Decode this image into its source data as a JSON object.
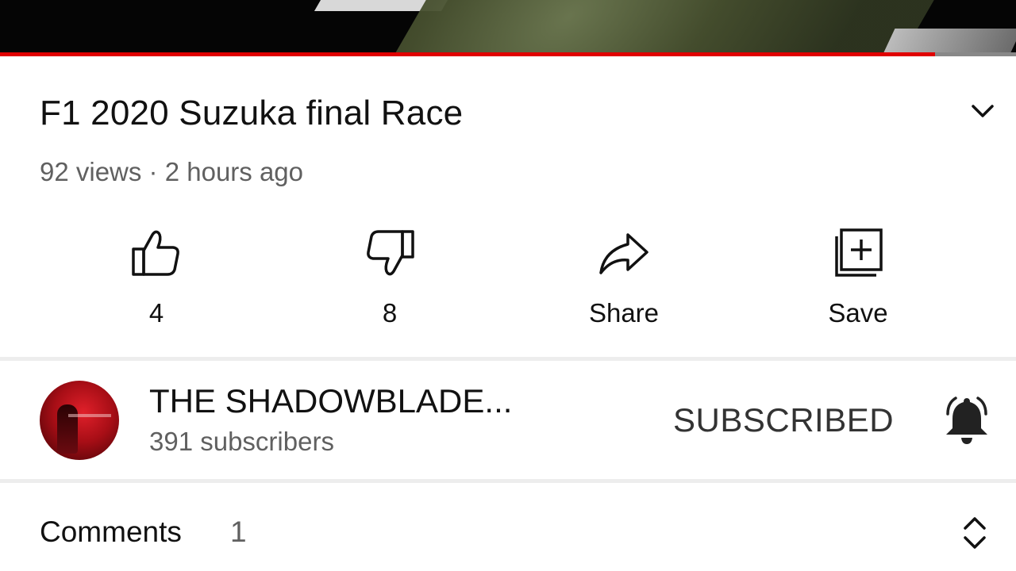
{
  "player": {
    "progress_fraction": 0.92,
    "progress_color": "#e00000"
  },
  "video": {
    "title": "F1 2020 Suzuka final Race",
    "meta": "92 views · 2 hours ago",
    "expand_icon": "chevron-down-icon"
  },
  "actions": {
    "like": {
      "label": "4",
      "icon": "thumbs-up-icon"
    },
    "dislike": {
      "label": "8",
      "icon": "thumbs-down-icon"
    },
    "share": {
      "label": "Share",
      "icon": "share-arrow-icon"
    },
    "save": {
      "label": "Save",
      "icon": "add-to-playlist-icon"
    }
  },
  "channel": {
    "name": "THE SHADOWBLADE...",
    "subscribers": "391 subscribers",
    "subscribe_state": "SUBSCRIBED",
    "bell_icon": "notification-bell-icon"
  },
  "comments": {
    "label": "Comments",
    "count": "1",
    "sort_icon": "expand-collapse-icon"
  }
}
